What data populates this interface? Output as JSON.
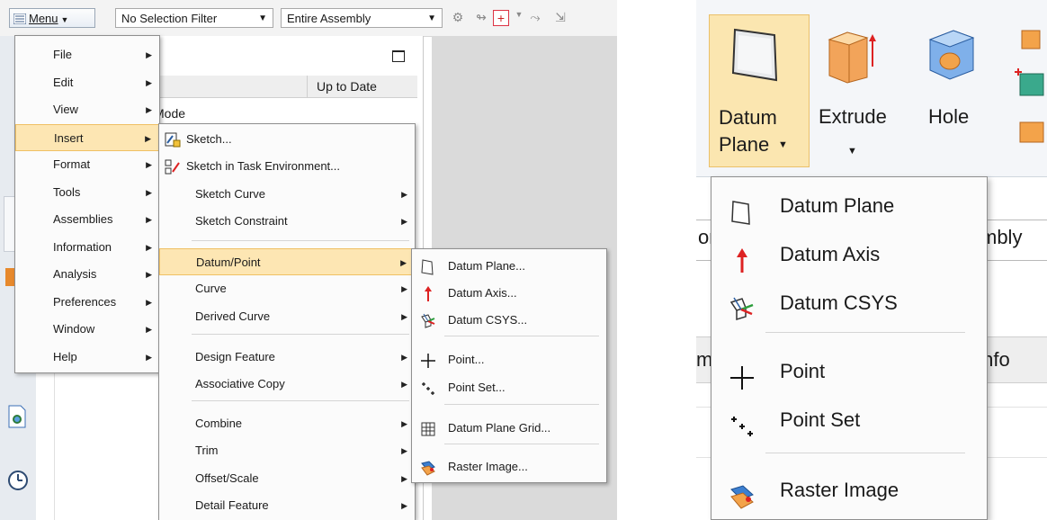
{
  "toolbar": {
    "menu_label": "Menu",
    "selection_filter": "No Selection Filter",
    "scope": "Entire Assembly"
  },
  "nav_pane": {
    "column_header": "Up to Date",
    "mode_text": "Mode"
  },
  "main_menu": {
    "items": [
      {
        "label": "File",
        "underline": "F"
      },
      {
        "label": "Edit",
        "underline": "E"
      },
      {
        "label": "View",
        "underline": "V"
      },
      {
        "label": "Insert",
        "underline": "s"
      },
      {
        "label": "Format",
        "underline": "r"
      },
      {
        "label": "Tools",
        "underline": "T"
      },
      {
        "label": "Assemblies",
        "underline": "A"
      },
      {
        "label": "Information",
        "underline": "I"
      },
      {
        "label": "Analysis",
        "underline": "l"
      },
      {
        "label": "Preferences",
        "underline": "P"
      },
      {
        "label": "Window",
        "underline": "o"
      },
      {
        "label": "Help",
        "underline": "H"
      }
    ]
  },
  "insert_menu": {
    "items": [
      {
        "label": "Sketch...",
        "underline": "h"
      },
      {
        "label": "Sketch in Task Environment...",
        "underline": "v"
      },
      {
        "label": "Sketch Curve",
        "underline": "S"
      },
      {
        "label": "Sketch Constraint",
        "underline": "k"
      },
      {
        "label": "Datum/Point",
        "underline": "D"
      },
      {
        "label": "Curve",
        "underline": "C"
      },
      {
        "label": "Derived Curve",
        "underline": "u"
      },
      {
        "label": "Design Feature",
        "underline": "e"
      },
      {
        "label": "Associative Copy",
        "underline": "A"
      },
      {
        "label": "Combine",
        "underline": "b"
      },
      {
        "label": "Trim",
        "underline": "T"
      },
      {
        "label": "Offset/Scale",
        "underline": "O"
      },
      {
        "label": "Detail Feature",
        "underline": "l"
      }
    ]
  },
  "datum_menu": {
    "items": [
      {
        "label": "Datum Plane...",
        "underline": "D"
      },
      {
        "label": "Datum Axis...",
        "underline": "A"
      },
      {
        "label": "Datum CSYS...",
        "underline": "C"
      },
      {
        "label": "Point...",
        "underline": "P"
      },
      {
        "label": "Point Set...",
        "underline": "S"
      },
      {
        "label": "Datum Plane Grid...",
        "underline": "G"
      },
      {
        "label": "Raster Image...",
        "underline": "R"
      }
    ]
  },
  "ribbon": {
    "datum_plane_line1": "Datum",
    "datum_plane_line2": "Plane",
    "extrude": "Extrude",
    "hole": "Hole",
    "bg_fragment_1": "or",
    "bg_fragment_2": "mbly",
    "bg_fragment_3": "m",
    "bg_fragment_4": "Info"
  },
  "datum_dropdown": {
    "items": [
      {
        "label": "Datum Plane"
      },
      {
        "label": "Datum Axis"
      },
      {
        "label": "Datum CSYS"
      },
      {
        "label": "Point"
      },
      {
        "label": "Point Set"
      },
      {
        "label": "Raster Image"
      }
    ]
  }
}
